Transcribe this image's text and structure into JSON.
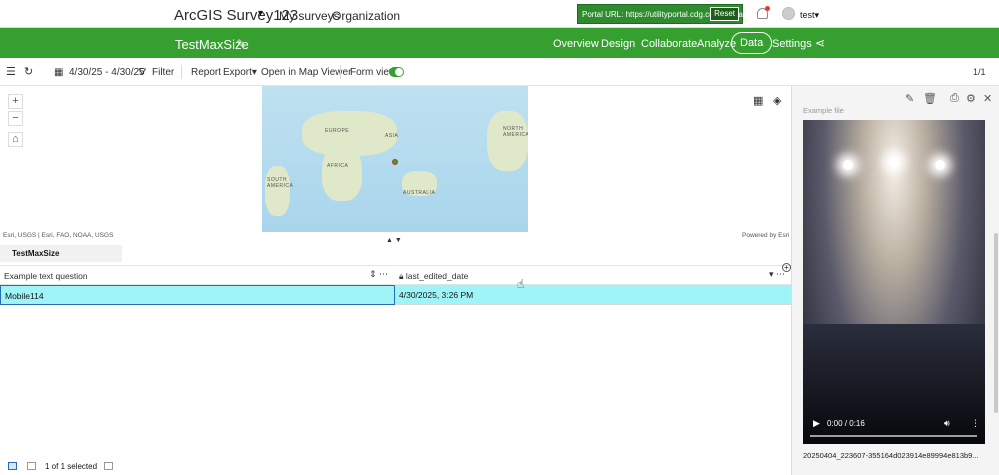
{
  "topbar": {
    "app_title": "ArcGIS Survey123",
    "nav": [
      "My surveys",
      "Organization"
    ],
    "portal_url": "Portal URL: https://utilityportal.cdg.co.th/portal",
    "reset_label": "Reset",
    "user": "test"
  },
  "survey": {
    "name": "TestMaxSize",
    "tabs": [
      "Overview",
      "Design",
      "Collaborate",
      "Analyze",
      "Data",
      "Settings"
    ],
    "active_tab": "Data"
  },
  "toolbar": {
    "date_range": "4/30/25 - 4/30/25",
    "filter": "Filter",
    "report": "Report",
    "export": "Export",
    "open_map": "Open in Map Viewer",
    "form_view": "Form view",
    "pager": "1/1"
  },
  "map": {
    "labels": [
      "EUROPE",
      "ASIA",
      "NORTH AMERICA",
      "AFRICA",
      "SOUTH AMERICA",
      "AUSTRALIA"
    ],
    "attribution": "Esri, USGS | Esri, FAO, NOAA, USGS",
    "powered": "Powered by Esri"
  },
  "table": {
    "sheet": "TestMaxSize",
    "columns": [
      "Example text question",
      "last_edited_date"
    ],
    "rows": [
      [
        "Mobile114",
        "4/30/2025, 3:26 PM"
      ]
    ],
    "footer_status": "1 of 1 selected"
  },
  "panel": {
    "field_label": "Example file",
    "video_time": "0:00 / 0:16",
    "file_name": "20250404_223607-355164d023914e89994e813b9..."
  },
  "colors": {
    "brand_green": "#35a02f",
    "selected_row": "#9ff4f8"
  }
}
